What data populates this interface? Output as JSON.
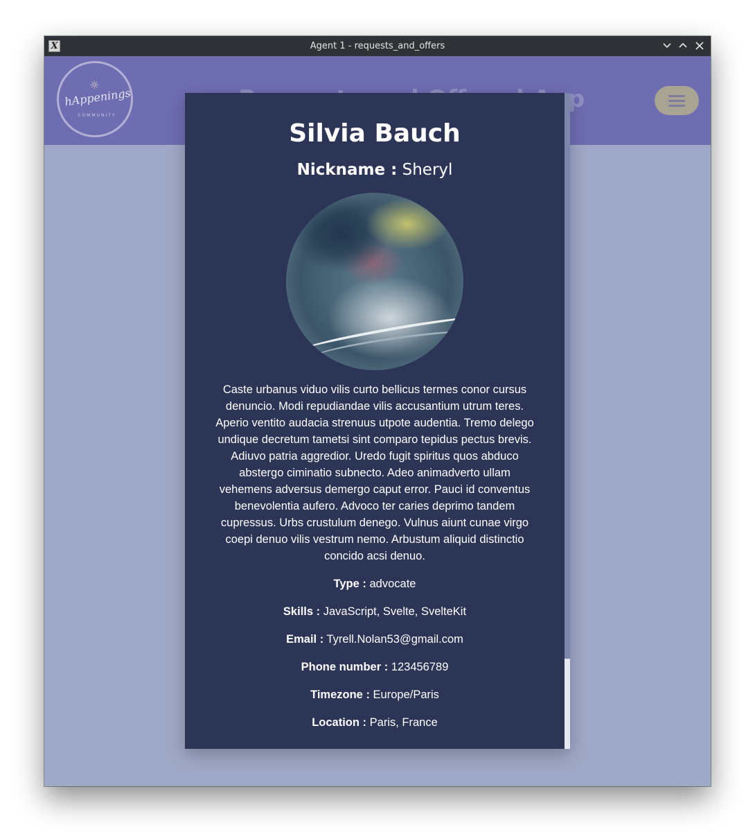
{
  "window": {
    "title": "Agent 1 - requests_and_offers",
    "controls": [
      "chevron-down-icon",
      "chevron-up-icon",
      "close-icon"
    ]
  },
  "header": {
    "logo_text": "hAppenings",
    "logo_subtext": "COMMUNITY",
    "title": "Requests and Offers hApp",
    "menu_icon": "hamburger-icon"
  },
  "profile": {
    "name": "Silvia Bauch",
    "nickname_label": "Nickname :",
    "nickname": "Sheryl",
    "bio": "Caste urbanus viduo vilis curto bellicus termes conor cursus denuncio. Modi repudiandae vilis accusantium utrum teres. Aperio ventito audacia strenuus utpote audentia. Tremo delego undique decretum tametsi sint comparo tepidus pectus brevis. Adiuvo patria aggredior. Uredo fugit spiritus quos abduco abstergo ciminatio subnecto. Adeo animadverto ullam vehemens adversus demergo caput error. Pauci id conventus benevolentia aufero. Advoco ter caries deprimo tandem cupressus. Urbs crustulum denego. Vulnus aiunt cunae virgo coepi denuo vilis vestrum nemo. Arbustum aliquid distinctio concido acsi denuo.",
    "fields": {
      "type": {
        "label": "Type :",
        "value": "advocate"
      },
      "skills": {
        "label": "Skills :",
        "value": "JavaScript, Svelte, SvelteKit"
      },
      "email": {
        "label": "Email :",
        "value": "Tyrell.Nolan53@gmail.com"
      },
      "phone": {
        "label": "Phone number :",
        "value": "123456789"
      },
      "timezone": {
        "label": "Timezone :",
        "value": "Europe/Paris"
      },
      "location": {
        "label": "Location :",
        "value": "Paris, France"
      }
    }
  },
  "colors": {
    "header_bg": "#6f6db2",
    "backdrop": "#9fa8c6",
    "modal_bg": "#2c3556",
    "menu_button": "#a8a392"
  }
}
